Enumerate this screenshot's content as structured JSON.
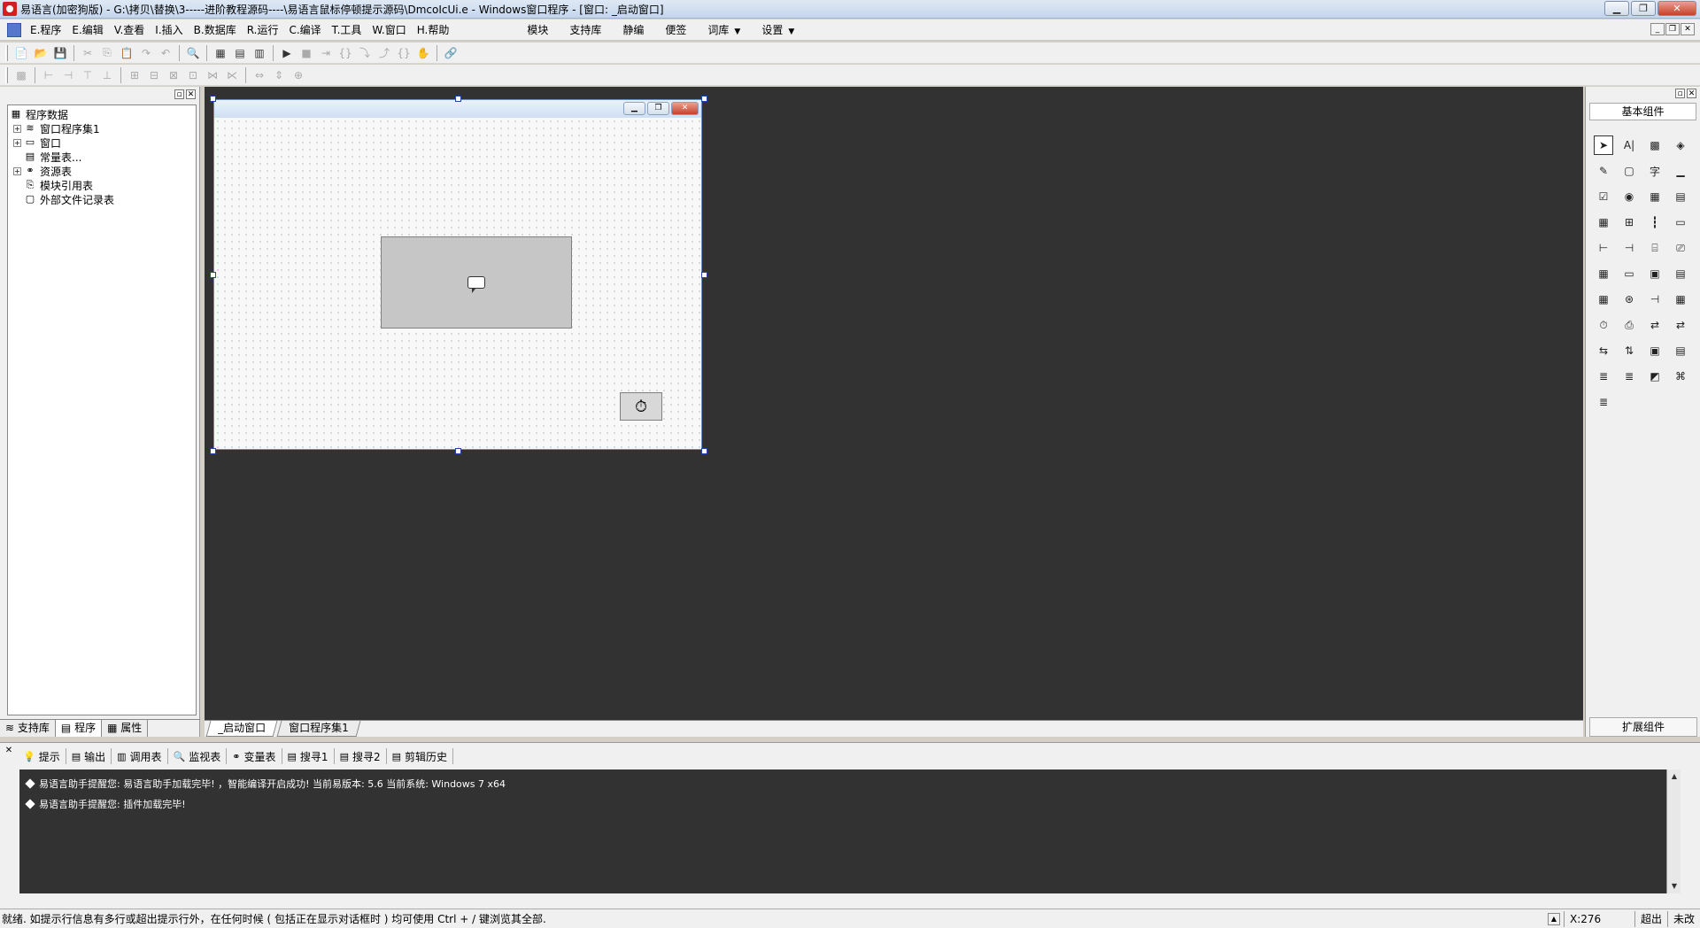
{
  "titlebar": {
    "title": "易语言(加密狗版) - G:\\拷贝\\替换\\3-----进阶教程源码----\\易语言鼠标停顿提示源码\\DmcoIcUi.e - Windows窗口程序 - [窗口: _启动窗口]",
    "controls": {
      "minimize": "▁",
      "restore": "❐",
      "close": "✕"
    }
  },
  "menubar": {
    "items": [
      "E.程序",
      "E.编辑",
      "V.查看",
      "I.插入",
      "B.数据库",
      "R.运行",
      "C.编译",
      "T.工具",
      "W.窗口",
      "H.帮助"
    ],
    "right_items": [
      "模块",
      "支持库",
      "静编",
      "便签"
    ],
    "dropdowns": [
      "词库",
      "设置"
    ],
    "arrow": "▼",
    "mdi_controls": [
      "_",
      "❐",
      "✕"
    ]
  },
  "toolbar1": {
    "icons": [
      "📄",
      "📂",
      "💾",
      "|",
      "✂",
      "⎘",
      "📋",
      "↷",
      "↶",
      "|",
      "🔍",
      "|",
      "▦",
      "▤",
      "▥",
      "|",
      "▶",
      "■",
      "⇥",
      "{}",
      "⤵",
      "⤴",
      "{}",
      "✋",
      "|",
      "🔗"
    ],
    "disabled": [
      4,
      5,
      6,
      7,
      8,
      17,
      18,
      19,
      20,
      21,
      22,
      23
    ]
  },
  "toolbar2": {
    "icons": [
      "▩",
      "|",
      "⊢",
      "⊣",
      "⊤",
      "⊥",
      "|",
      "⊞",
      "⊟",
      "⊠",
      "⊡",
      "⋈",
      "⋉",
      "|",
      "⇔",
      "⇕",
      "⊕"
    ]
  },
  "leftpanel": {
    "head_controls": [
      "▫",
      "✕"
    ],
    "tree": [
      {
        "label": "程序数据",
        "level": 0,
        "expander": "",
        "icon": "▦"
      },
      {
        "label": "窗口程序集1",
        "level": 1,
        "expander": "+",
        "icon": "≋"
      },
      {
        "label": "窗口",
        "level": 1,
        "expander": "+",
        "icon": "▭"
      },
      {
        "label": "常量表...",
        "level": 1,
        "expander": "",
        "icon": "▤"
      },
      {
        "label": "资源表",
        "level": 1,
        "expander": "+",
        "icon": "⚭"
      },
      {
        "label": "模块引用表",
        "level": 1,
        "expander": "",
        "icon": "⎘"
      },
      {
        "label": "外部文件记录表",
        "level": 1,
        "expander": "",
        "icon": "▢"
      }
    ],
    "tabs": [
      {
        "label": "支持库",
        "icon": "≋"
      },
      {
        "label": "程序",
        "icon": "▤"
      },
      {
        "label": "属性",
        "icon": "▦"
      }
    ]
  },
  "workspace": {
    "design_window": {
      "controls": [
        "▁",
        "❐",
        "✕"
      ]
    },
    "timer_icon": "⏱",
    "tabs": [
      "_启动窗口",
      "窗口程序集1"
    ]
  },
  "rightpanel": {
    "head_controls": [
      "▫",
      "✕"
    ],
    "group_title": "基本组件",
    "footer_title": "扩展组件",
    "palette": [
      "➤",
      "A|",
      "▩",
      "◈",
      "✎",
      "▢",
      "字",
      "▁",
      "☑",
      "◉",
      "▦",
      "▤",
      "▦",
      "⊞",
      "┇",
      "▭",
      "⊢",
      "⊣",
      "⌸",
      "⎚",
      "▦",
      "▭",
      "▣",
      "▤",
      "▦",
      "⊛",
      "⊣",
      "▦",
      "⏱",
      "⎙",
      "⇄",
      "⇄",
      "⇆",
      "⇅",
      "▣",
      "▤",
      "≣",
      "≣",
      "◩",
      "⌘",
      "≣"
    ]
  },
  "bottompanel": {
    "close": "✕",
    "tabs": [
      {
        "label": "提示",
        "icon": "💡"
      },
      {
        "label": "输出",
        "icon": "▤"
      },
      {
        "label": "调用表",
        "icon": "▥"
      },
      {
        "label": "监视表",
        "icon": "🔍"
      },
      {
        "label": "变量表",
        "icon": "⚭"
      },
      {
        "label": "搜寻1",
        "icon": "▤"
      },
      {
        "label": "搜寻2",
        "icon": "▤"
      },
      {
        "label": "剪辑历史",
        "icon": "▤"
      }
    ],
    "lines": [
      "易语言助手提醒您: 易语言助手加载完毕! ，智能编译开启成功! 当前易版本: 5.6 当前系统: Windows 7 x64",
      "易语言助手提醒您: 插件加载完毕!"
    ],
    "scroll_up": "▲",
    "scroll_down": "▼"
  },
  "statusbar": {
    "message": "就绪. 如提示行信息有多行或超出提示行外，在任何时候 ( 包括正在显示对话框时 ) 均可使用 Ctrl + / 键浏览其全部.",
    "up_arrow": "▲",
    "position": "X:276",
    "overwrite": "超出",
    "modified": "未改"
  }
}
